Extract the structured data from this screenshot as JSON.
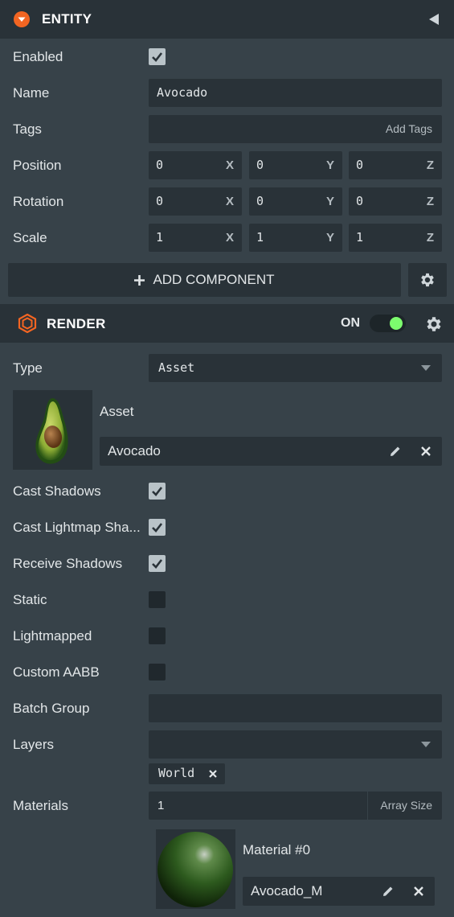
{
  "entity": {
    "title": "ENTITY",
    "enabled_label": "Enabled",
    "enabled": true,
    "name_label": "Name",
    "name_value": "Avocado",
    "tags_label": "Tags",
    "tags_placeholder": "Add Tags",
    "position_label": "Position",
    "position": {
      "x": "0",
      "y": "0",
      "z": "0"
    },
    "rotation_label": "Rotation",
    "rotation": {
      "x": "0",
      "y": "0",
      "z": "0"
    },
    "scale_label": "Scale",
    "scale": {
      "x": "1",
      "y": "1",
      "z": "1"
    },
    "axis": {
      "x": "X",
      "y": "Y",
      "z": "Z"
    },
    "add_component_label": "ADD COMPONENT"
  },
  "render": {
    "title": "RENDER",
    "toggle_label": "ON",
    "toggle_on": true,
    "type_label": "Type",
    "type_value": "Asset",
    "asset_label": "Asset",
    "asset_value": "Avocado",
    "cast_shadows_label": "Cast Shadows",
    "cast_lightmap_label": "Cast Lightmap Sha...",
    "receive_shadows_label": "Receive Shadows",
    "static_label": "Static",
    "lightmapped_label": "Lightmapped",
    "custom_aabb_label": "Custom AABB",
    "batch_group_label": "Batch Group",
    "layers_label": "Layers",
    "layer_tag": "World",
    "materials_label": "Materials",
    "materials_count": "1",
    "array_size_label": "Array Size",
    "material_slot_label": "Material #0",
    "material_value": "Avocado_M"
  },
  "colors": {
    "accent_orange": "#f26522",
    "toggle_green": "#7cfc6e",
    "panel_bg": "#374249",
    "field_bg": "#293238"
  }
}
